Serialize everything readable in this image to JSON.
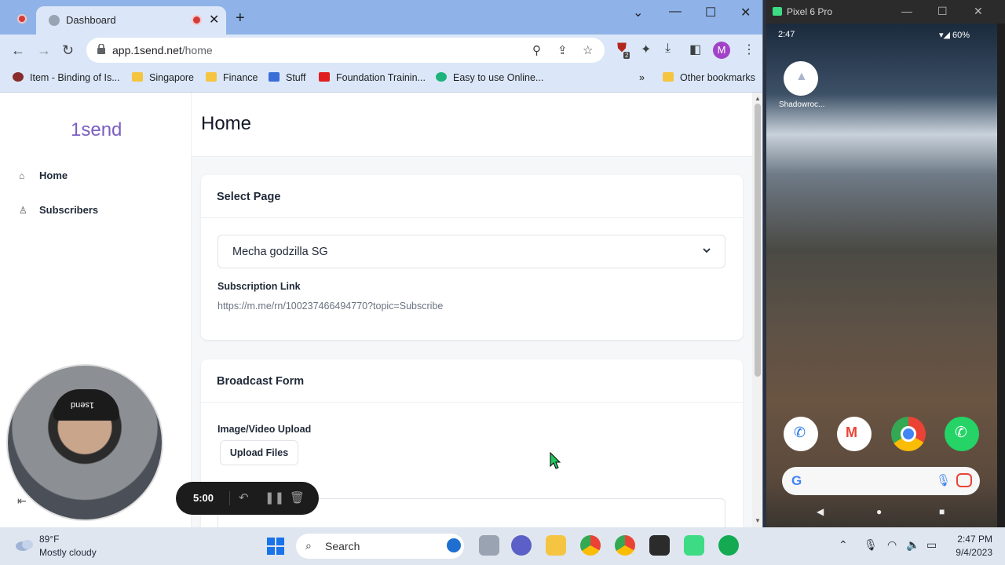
{
  "browser": {
    "tab_title": "Dashboard",
    "url_host": "app.1send.net",
    "url_path": "/home",
    "profile_initial": "M",
    "extension_badge": "2",
    "bookmarks": [
      {
        "label": "Item - Binding of Is..."
      },
      {
        "label": "Singapore"
      },
      {
        "label": "Finance"
      },
      {
        "label": "Stuff"
      },
      {
        "label": "Foundation Trainin..."
      },
      {
        "label": "Easy to use Online..."
      }
    ],
    "bookmarks_overflow": "»",
    "other_bookmarks": "Other bookmarks"
  },
  "app": {
    "brand": "1send",
    "nav": [
      {
        "label": "Home"
      },
      {
        "label": "Subscribers"
      }
    ],
    "page_title": "Home",
    "select_page": {
      "heading": "Select Page",
      "selected": "Mecha godzilla SG",
      "link_label": "Subscription Link",
      "link_value": "https://m.me/rn/100237466494770?topic=Subscribe"
    },
    "broadcast": {
      "heading": "Broadcast Form",
      "upload_label": "Image/Video Upload",
      "upload_button": "Upload Files"
    }
  },
  "recorder": {
    "time": "5:00"
  },
  "webcam": {
    "cap_text": "1send"
  },
  "phone": {
    "window_title": "Pixel 6 Pro",
    "status_time": "2:47",
    "battery": "60%",
    "home_app_label": "Shadowroc..."
  },
  "taskbar": {
    "temperature": "89°F",
    "weather": "Mostly cloudy",
    "search_label": "Search",
    "time": "2:47 PM",
    "date": "9/4/2023"
  },
  "colors": {
    "brand": "#7b5fc0",
    "tab_bar": "#8fb3e8",
    "record": "#d23b3b"
  }
}
